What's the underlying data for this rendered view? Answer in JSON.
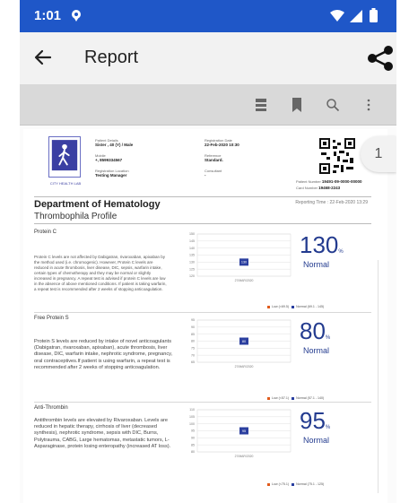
{
  "status_bar": {
    "time": "1:01"
  },
  "app_bar": {
    "title": "Report"
  },
  "page_indicator": "1",
  "header": {
    "patient_label": "Patient Details",
    "patient_value": "Sister , 40 (Y) / Male",
    "mobile_label": "Mobile",
    "mobile_value": "+, 8599334567",
    "reg_loc_label": "Registration Location",
    "reg_loc_value": "Testing Manager",
    "reg_date_label": "Registration Date",
    "reg_date_value": "22-Feb-2020 10:30",
    "reference_label": "Reference",
    "reference_value": "Standard.",
    "consultant_label": "Consultant",
    "consultant_value": "-",
    "patient_number_label": "Patient Number",
    "patient_number_value": "19491-09-0000-00000",
    "card_number_label": "Card Number",
    "card_number_value": "19468-2243",
    "logo_text": "CITY HEALTH LAB"
  },
  "department": "Department of Hematology",
  "reporting_time": "Reporting Time : 22-Feb-2020 13:29",
  "profile": "Thrombophila Profile",
  "tests": [
    {
      "name": "Protein C",
      "description": "Protein C levels are not affected by Dabigatran, rivaroxaban, apixaban by the method used (i.e. chromogenic). However, Protein C levels are reduced in acute thrombosis, liver disease, DIC, sepsis, warfarin intake, certain types of chemotherapy and they may be normal or slightly increased in pregnancy. A repeat test is advised if protein C levels are low in the absence of above mentioned conditions. If patient is taking warfarin, a repeat test is recommended after 2 weeks of stopping anticoagulation.",
      "value": "130",
      "unit": "%",
      "status": "Normal",
      "legend_low": "Low (<69.5)",
      "legend_normal": "Normal (69.1 - 145)",
      "axis_date": "27/MAR/2020",
      "chart_data": {
        "type": "bar",
        "categories": [
          "27/MAR/2020"
        ],
        "values": [
          130
        ],
        "ylim": [
          120,
          150
        ],
        "yticks": [
          120,
          125,
          130,
          135,
          140,
          145,
          150
        ]
      }
    },
    {
      "name": "Free Protein S",
      "description": "Protein S levels are reduced by intake of novel anticoagulants (Dabigatran, rivaroxaban, apixaban), acute thrombosis, liver disease, DIC, warfarin intake, nephrotic syndrome, pregnancy, oral contraceptives.If patient is using warfarin, a repeat test is recommended after 2 weeks of stopping anticoagulation.",
      "value": "80",
      "unit": "%",
      "status": "Normal",
      "legend_low": "Low (<57.1)",
      "legend_normal": "Normal (57.1 - 140)",
      "axis_date": "27/MAR/2020",
      "chart_data": {
        "type": "bar",
        "categories": [
          "27/MAR/2020"
        ],
        "values": [
          80
        ],
        "ylim": [
          65,
          95
        ],
        "yticks": [
          65,
          70,
          75,
          80,
          85,
          90,
          95
        ]
      }
    },
    {
      "name": "Anti-Thrombin",
      "description": "Antithrombin levels are elevated by Rivaroxaban. Levels are reduced in hepatic therapy, cirrhosis of liver (decreased synthesis), nephrotic syndrome, sepsis with DIC, Burns, Polytrauma, CABG, Large hematomas, metastatic tumors, L-Asparaginase, protein losing enteropathy (increased AT loss).",
      "value": "95",
      "unit": "%",
      "status": "Normal",
      "legend_low": "Low (<75.1)",
      "legend_normal": "Normal (75.1 - 125)",
      "axis_date": "27/MAR/2020",
      "chart_data": {
        "type": "bar",
        "categories": [
          "27/MAR/2020"
        ],
        "values": [
          95
        ],
        "ylim": [
          80,
          110
        ],
        "yticks": [
          80,
          85,
          90,
          95,
          100,
          105,
          110
        ]
      }
    }
  ],
  "colors": {
    "status_bar": "#1f57c8",
    "value": "#233b8f",
    "bar": "#2b3f9f",
    "low": "#e15b1c",
    "normal": "#2a3fa0"
  }
}
